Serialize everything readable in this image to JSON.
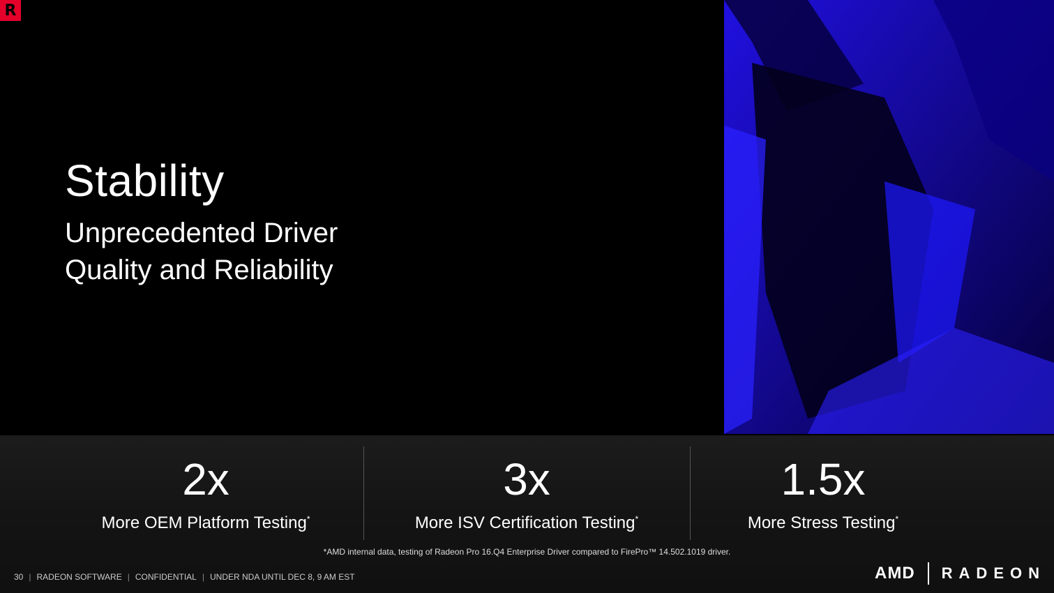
{
  "logo": {
    "letter": "R",
    "color": "#e4002b"
  },
  "title": "Stability",
  "subtitle": "Unprecedented Driver\nQuality and Reliability",
  "stats": [
    {
      "value": "2x",
      "label": "More OEM Platform Testing",
      "mark": "*"
    },
    {
      "value": "3x",
      "label": "More ISV Certification Testing",
      "mark": "*"
    },
    {
      "value": "1.5x",
      "label": "More Stress Testing",
      "mark": "*"
    }
  ],
  "footnote": "*AMD internal data, testing of Radeon Pro 16.Q4 Enterprise Driver compared to FirePro™ 14.502.1019 driver.",
  "footer": {
    "page_number": "30",
    "section": "RADEON SOFTWARE",
    "classification": "CONFIDENTIAL",
    "embargo": "UNDER NDA UNTIL DEC 8, 9 AM EST"
  },
  "brand": {
    "amd": "AMD",
    "radeon": "RADEON"
  },
  "colors": {
    "accent_red": "#e4002b",
    "photo_blue": "#1a10c8"
  }
}
